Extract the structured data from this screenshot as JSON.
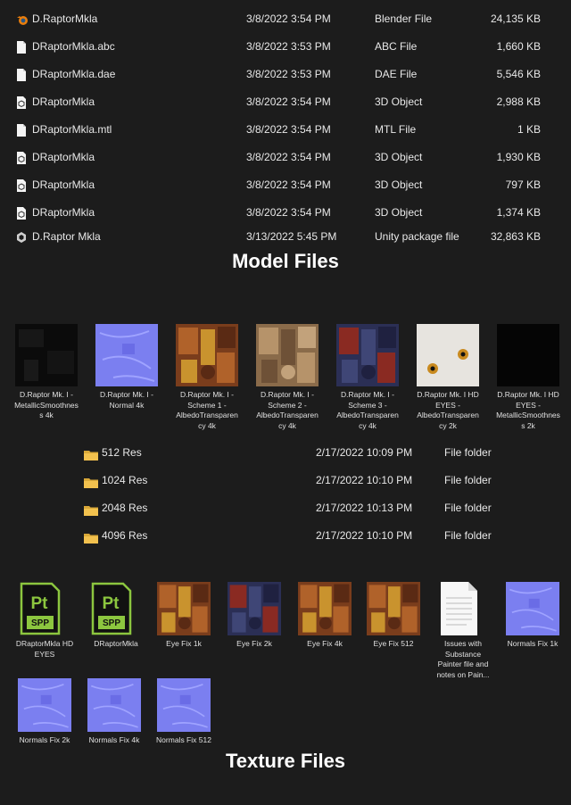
{
  "model_files": [
    {
      "name": "D.RaptorMkla",
      "date": "3/8/2022 3:54 PM",
      "type": "Blender File",
      "size": "24,135 KB",
      "icon": "blender-icon"
    },
    {
      "name": "DRaptorMkla.abc",
      "date": "3/8/2022 3:53 PM",
      "type": "ABC File",
      "size": "1,660 KB",
      "icon": "file-icon"
    },
    {
      "name": "DRaptorMkla.dae",
      "date": "3/8/2022 3:53 PM",
      "type": "DAE File",
      "size": "5,546 KB",
      "icon": "file-icon"
    },
    {
      "name": "DRaptorMkla",
      "date": "3/8/2022 3:54 PM",
      "type": "3D Object",
      "size": "2,988 KB",
      "icon": "3d-object-icon"
    },
    {
      "name": "DRaptorMkla.mtl",
      "date": "3/8/2022 3:54 PM",
      "type": "MTL File",
      "size": "1 KB",
      "icon": "file-icon"
    },
    {
      "name": "DRaptorMkla",
      "date": "3/8/2022 3:54 PM",
      "type": "3D Object",
      "size": "1,930 KB",
      "icon": "3d-object-icon"
    },
    {
      "name": "DRaptorMkla",
      "date": "3/8/2022 3:54 PM",
      "type": "3D Object",
      "size": "797 KB",
      "icon": "3d-object-icon"
    },
    {
      "name": "DRaptorMkla",
      "date": "3/8/2022 3:54 PM",
      "type": "3D Object",
      "size": "1,374 KB",
      "icon": "3d-object-icon"
    },
    {
      "name": "D.Raptor Mkla",
      "date": "3/13/2022 5:45 PM",
      "type": "Unity package file",
      "size": "32,863 KB",
      "icon": "unity-icon"
    }
  ],
  "model_title": "Model Files",
  "textures_top": [
    {
      "caption": "D.Raptor Mk. I - MetallicSmoothness 4k",
      "kind": "black-noise"
    },
    {
      "caption": "D.Raptor Mk. I - Normal 4k",
      "kind": "normal"
    },
    {
      "caption": "D.Raptor Mk. I - Scheme 1 - AlbedoTransparency 4k",
      "kind": "albedo-orange"
    },
    {
      "caption": "D.Raptor Mk. I - Scheme 2 - AlbedoTransparency 4k",
      "kind": "albedo-tan"
    },
    {
      "caption": "D.Raptor Mk. I - Scheme 3 - AlbedoTransparency 4k",
      "kind": "albedo-blue"
    },
    {
      "caption": "D.Raptor Mk. I HD EYES - AlbedoTransparency 2k",
      "kind": "eyes"
    },
    {
      "caption": "D.Raptor Mk. I HD EYES - MetallicSmoothness 2k",
      "kind": "black"
    }
  ],
  "folders": [
    {
      "name": "512 Res",
      "date": "2/17/2022 10:09 PM",
      "type": "File folder"
    },
    {
      "name": "1024 Res",
      "date": "2/17/2022 10:10 PM",
      "type": "File folder"
    },
    {
      "name": "2048 Res",
      "date": "2/17/2022 10:13 PM",
      "type": "File folder"
    },
    {
      "name": "4096 Res",
      "date": "2/17/2022 10:10 PM",
      "type": "File folder"
    }
  ],
  "textures_bottom": [
    {
      "caption": "DRaptorMkla HD EYES",
      "kind": "spp",
      "label_top": "Pt",
      "label_bottom": "SPP"
    },
    {
      "caption": "DRaptorMkla",
      "kind": "spp",
      "label_top": "Pt",
      "label_bottom": "SPP"
    },
    {
      "caption": "Eye Fix 1k",
      "kind": "albedo-orange"
    },
    {
      "caption": "Eye Fix 2k",
      "kind": "albedo-blue"
    },
    {
      "caption": "Eye Fix 4k",
      "kind": "albedo-orange"
    },
    {
      "caption": "Eye Fix 512",
      "kind": "albedo-orange"
    },
    {
      "caption": "Issues with Substance Painter file and notes on Pain...",
      "kind": "document"
    },
    {
      "caption": "Normals Fix 1k",
      "kind": "normal"
    },
    {
      "caption": "Normals Fix 2k",
      "kind": "normal"
    },
    {
      "caption": "Normals Fix 4k",
      "kind": "normal"
    },
    {
      "caption": "Normals Fix 512",
      "kind": "normal"
    }
  ],
  "texture_title": "Texture Files",
  "colors": {
    "background": "#1c1c1c",
    "folder": "#f2c14e",
    "spp_green": "#8cc63f",
    "normal": "#7b7ff0"
  }
}
